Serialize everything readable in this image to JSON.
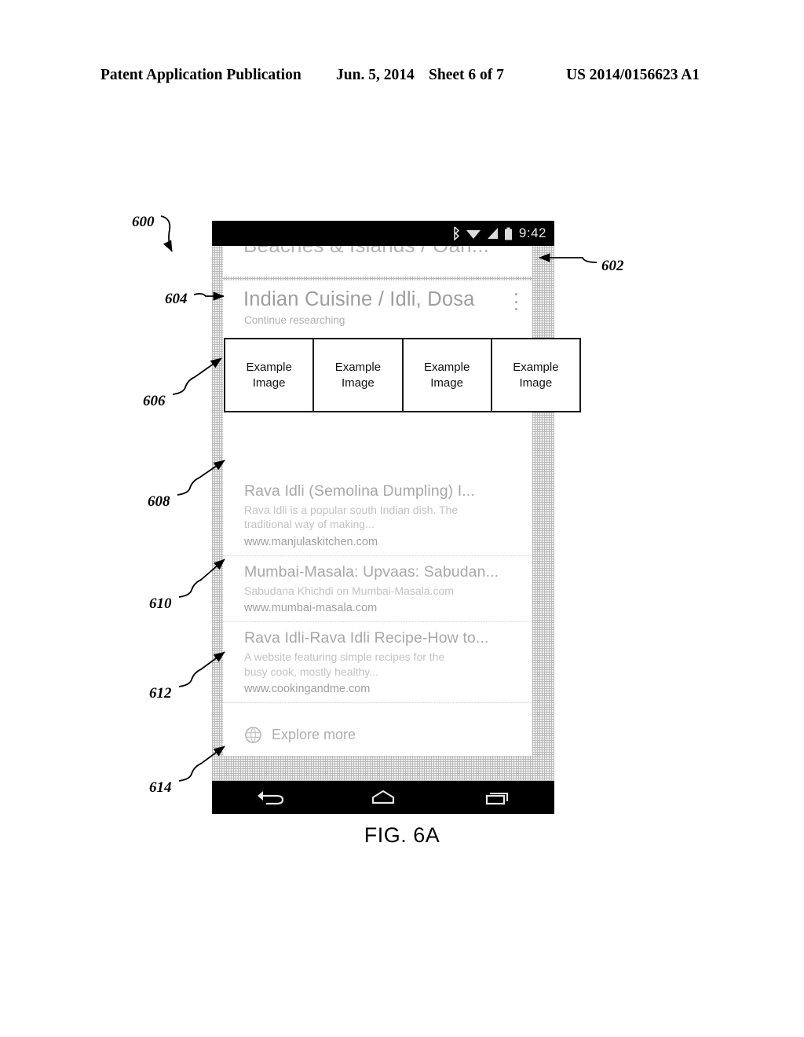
{
  "header": {
    "publication": "Patent Application Publication",
    "date": "Jun. 5, 2014",
    "sheet": "Sheet 6 of 7",
    "patent_number": "US 2014/0156623 A1"
  },
  "figure": {
    "caption": "FIG. 6A"
  },
  "phone": {
    "status_bar": {
      "time": "9:42",
      "icons": [
        "bluetooth-icon",
        "wifi-icon",
        "signal-icon",
        "battery-icon"
      ]
    },
    "nav_bar": {
      "back_label": "back-button",
      "home_label": "home-button",
      "recents_label": "recents-button"
    }
  },
  "previous_card": {
    "title": "Beaches & Islands / Oah..."
  },
  "card": {
    "title": "Indian Cuisine / Idli, Dosa",
    "subtitle": "Continue researching",
    "overflow_icon": "overflow-menu-icon",
    "images": [
      {
        "line1": "Example",
        "line2": "Image"
      },
      {
        "line1": "Example",
        "line2": "Image"
      },
      {
        "line1": "Example",
        "line2": "Image"
      },
      {
        "line1": "Example",
        "line2": "Image"
      }
    ],
    "results": [
      {
        "title": "Rava Idli (Semolina Dumpling) I...",
        "snippet": "Rava Idli is a popular south Indian dish. The traditional way of making...",
        "url": "www.manjulaskitchen.com"
      },
      {
        "title": "Mumbai-Masala: Upvaas: Sabudan...",
        "snippet": "Sabudana Khichdi on Mumbai-Masala.com",
        "url": "www.mumbai-masala.com"
      },
      {
        "title": "Rava Idli-Rava Idli Recipe-How to...",
        "snippet": "A website featuring simple recipes for the busy cook, mostly healthy...",
        "url": "www.cookingandme.com"
      }
    ],
    "explore": {
      "label": "Explore more",
      "icon": "globe-icon"
    }
  },
  "reference_numerals": [
    {
      "id": "600",
      "label": "600"
    },
    {
      "id": "602",
      "label": "602"
    },
    {
      "id": "604",
      "label": "604"
    },
    {
      "id": "606",
      "label": "606"
    },
    {
      "id": "608",
      "label": "608"
    },
    {
      "id": "610",
      "label": "610"
    },
    {
      "id": "612",
      "label": "612"
    },
    {
      "id": "614",
      "label": "614"
    }
  ]
}
